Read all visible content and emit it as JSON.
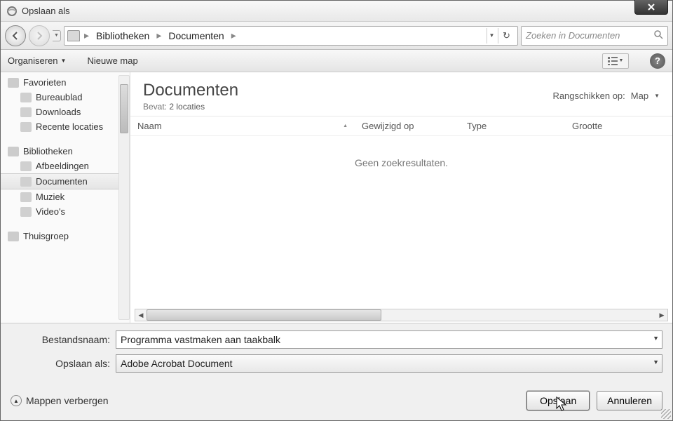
{
  "window": {
    "title": "Opslaan als"
  },
  "nav": {
    "breadcrumb": [
      "Bibliotheken",
      "Documenten"
    ],
    "search_placeholder": "Zoeken in Documenten"
  },
  "toolbar": {
    "organize": "Organiseren",
    "new_folder": "Nieuwe map"
  },
  "sidebar": {
    "favorites_label": "Favorieten",
    "favorites": [
      "Bureaublad",
      "Downloads",
      "Recente locaties"
    ],
    "libraries_label": "Bibliotheken",
    "libraries": [
      "Afbeeldingen",
      "Documenten",
      "Muziek",
      "Video's"
    ],
    "homegroup_label": "Thuisgroep"
  },
  "main": {
    "heading": "Documenten",
    "sub_prefix": "Bevat:",
    "sub_value": "2 locaties",
    "arrange_label": "Rangschikken op:",
    "arrange_value": "Map",
    "columns": {
      "name": "Naam",
      "modified": "Gewijzigd op",
      "type": "Type",
      "size": "Grootte"
    },
    "empty_text": "Geen zoekresultaten."
  },
  "fields": {
    "filename_label": "Bestandsnaam:",
    "filename_value": "Programma vastmaken aan taakbalk",
    "saveas_label": "Opslaan als:",
    "saveas_value": "Adobe Acrobat Document"
  },
  "footer": {
    "hide_folders": "Mappen verbergen",
    "save": "Opslaan",
    "cancel": "Annuleren"
  }
}
